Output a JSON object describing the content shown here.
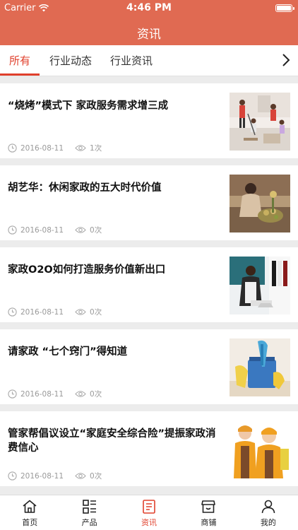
{
  "status_bar": {
    "carrier": "Carrier",
    "time": "4:46 PM"
  },
  "header": {
    "title": "资讯"
  },
  "tabs": [
    {
      "label": "所有",
      "active": true
    },
    {
      "label": "行业动态",
      "active": false
    },
    {
      "label": "行业资讯",
      "active": false
    }
  ],
  "news": [
    {
      "title": "“烧烤”模式下 家政服务需求增三成",
      "date": "2016-08-11",
      "views": "1次"
    },
    {
      "title": "胡艺华：休闲家政的五大时代价值",
      "date": "2016-08-11",
      "views": "0次"
    },
    {
      "title": "家政O2O如何打造服务价值新出口",
      "date": "2016-08-11",
      "views": "0次"
    },
    {
      "title": "请家政 “七个窍门”得知道",
      "date": "2016-08-11",
      "views": "0次"
    },
    {
      "title": "管家帮倡议设立“家庭安全综合险”提振家政消费信心",
      "date": "2016-08-11",
      "views": "0次"
    }
  ],
  "tabbar": [
    {
      "label": "首页",
      "icon": "home-icon",
      "active": false
    },
    {
      "label": "产品",
      "icon": "product-grid-icon",
      "active": false
    },
    {
      "label": "资讯",
      "icon": "news-icon",
      "active": true
    },
    {
      "label": "商铺",
      "icon": "store-icon",
      "active": false
    },
    {
      "label": "我的",
      "icon": "user-icon",
      "active": false
    }
  ],
  "colors": {
    "header": "#e06a52",
    "accent": "#e0402c",
    "meta": "#999999"
  }
}
